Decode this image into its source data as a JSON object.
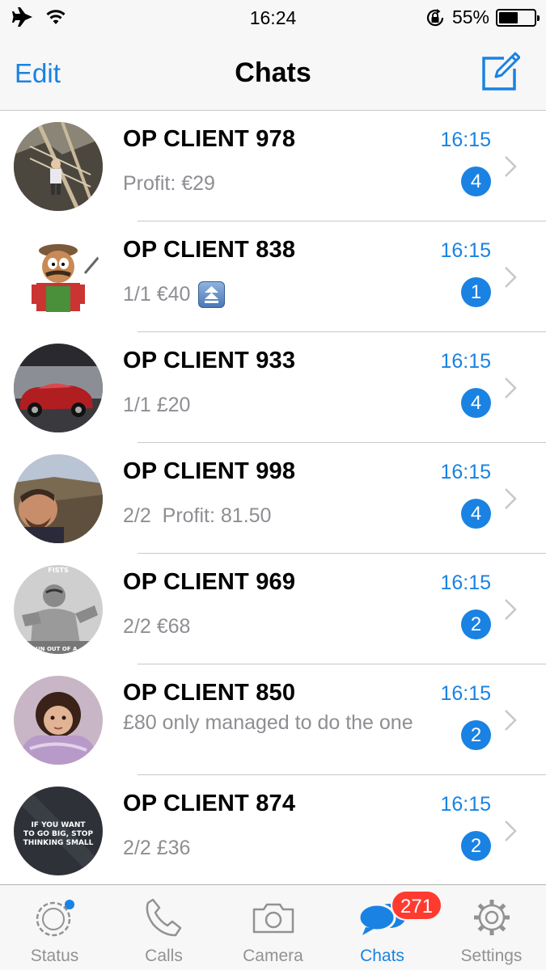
{
  "status_bar": {
    "time": "16:24",
    "battery_percent": "55%",
    "battery_level": 0.55,
    "icons": [
      "airplane-icon",
      "wifi-icon",
      "rotation-lock-icon",
      "battery-icon"
    ]
  },
  "nav": {
    "edit_label": "Edit",
    "title": "Chats",
    "compose_icon": "compose-icon"
  },
  "chats": [
    {
      "name": "OP CLIENT 978",
      "time": "16:15",
      "preview": "Profit: €29",
      "unread": "4"
    },
    {
      "name": "OP CLIENT 838",
      "time": "16:15",
      "preview": "1/1 €40",
      "unread": "1",
      "preview_icon": "up-arrows-emoji"
    },
    {
      "name": "OP CLIENT 933",
      "time": "16:15",
      "preview": "1/1 £20",
      "unread": "4"
    },
    {
      "name": "OP CLIENT 998",
      "time": "16:15",
      "preview": "2/2  Profit: 81.50",
      "unread": "4"
    },
    {
      "name": "OP CLIENT 969",
      "time": "16:15",
      "preview": "2/2 €68",
      "unread": "2"
    },
    {
      "name": "OP CLIENT 850",
      "time": "16:15",
      "preview": "£80 only managed to do the one",
      "unread": "2"
    },
    {
      "name": "OP CLIENT 874",
      "time": "16:15",
      "preview": "2/2 £36",
      "unread": "2"
    }
  ],
  "avatar_text": {
    "969_top": "FISTS",
    "969_bottom": "RUN OUT OF A",
    "874_lines": [
      "IF YOU WANT",
      "TO GO BIG, STOP",
      "THINKING SMALL"
    ]
  },
  "tabs": [
    {
      "label": "Status",
      "icon": "status-icon"
    },
    {
      "label": "Calls",
      "icon": "phone-icon"
    },
    {
      "label": "Camera",
      "icon": "camera-icon"
    },
    {
      "label": "Chats",
      "icon": "chat-bubbles-icon",
      "badge": "271",
      "active": true
    },
    {
      "label": "Settings",
      "icon": "gear-icon"
    }
  ],
  "colors": {
    "accent": "#1a82e2",
    "badge_red": "#ff3b30",
    "secondary_text": "#8e8e93"
  }
}
